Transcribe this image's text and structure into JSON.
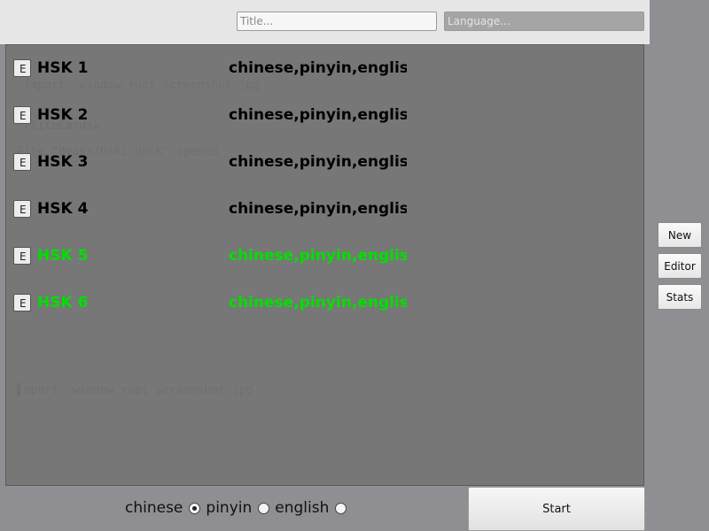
{
  "header": {
    "title_placeholder": "Title...",
    "language_placeholder": "Language..."
  },
  "terminal_ghost": {
    "line1": ".import -window root screenshot.jpg",
    "line2": "./liteCardsk",
    "line3": "File \"decks/hsk1.deck\" opened",
    "line4": "▌mport -window root screenshot.jpg"
  },
  "decks": [
    {
      "edit_label": "E",
      "title": "HSK 1",
      "languages": "chinese,pinyin,english",
      "color": "#000000"
    },
    {
      "edit_label": "E",
      "title": "HSK 2",
      "languages": "chinese,pinyin,english",
      "color": "#000000"
    },
    {
      "edit_label": "E",
      "title": "HSK 3",
      "languages": "chinese,pinyin,english",
      "color": "#000000"
    },
    {
      "edit_label": "E",
      "title": "HSK 4",
      "languages": "chinese,pinyin,english",
      "color": "#000000"
    },
    {
      "edit_label": "E",
      "title": "HSK 5",
      "languages": "chinese,pinyin,english",
      "color": "#00e000"
    },
    {
      "edit_label": "E",
      "title": "HSK 6",
      "languages": "chinese,pinyin,english",
      "color": "#00e000"
    }
  ],
  "language_choices": {
    "chinese": "chinese",
    "pinyin": "pinyin",
    "english": "english",
    "selected": "chinese"
  },
  "actions": {
    "start": "Start",
    "new": "New",
    "editor": "Editor",
    "stats": "Stats"
  }
}
